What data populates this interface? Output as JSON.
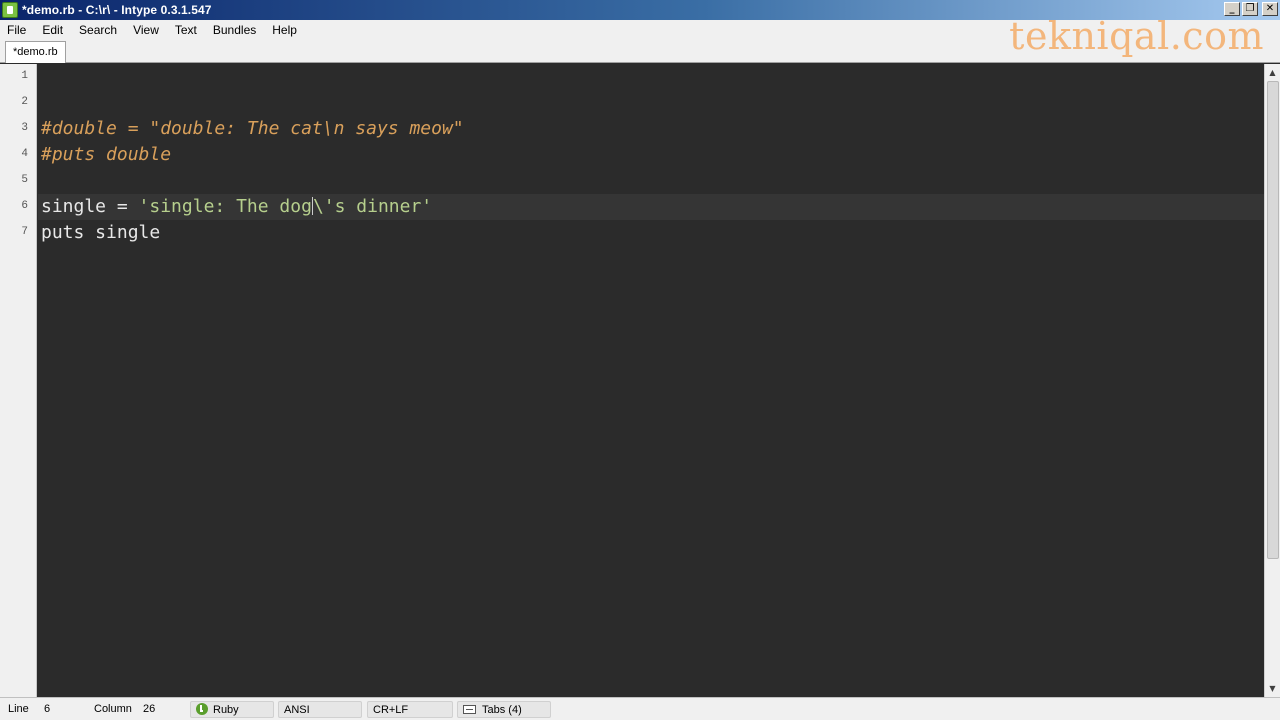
{
  "window": {
    "title": "*demo.rb - C:\\r\\ - Intype 0.3.1.547",
    "controls": {
      "minimize": "_",
      "maximize": "❐",
      "close": "✕"
    }
  },
  "menu": [
    "File",
    "Edit",
    "Search",
    "View",
    "Text",
    "Bundles",
    "Help"
  ],
  "tab": {
    "label": "*demo.rb"
  },
  "watermark": "tekniqal.com",
  "editor": {
    "line_numbers": [
      "1",
      "2",
      "3",
      "4",
      "5",
      "6",
      "7"
    ],
    "current_line": 6,
    "lines": [
      {
        "tokens": []
      },
      {
        "tokens": []
      },
      {
        "tokens": [
          {
            "type": "comment",
            "text": "#double = \"double: The cat\\n says meow\""
          }
        ]
      },
      {
        "tokens": [
          {
            "type": "comment",
            "text": "#puts double"
          }
        ]
      },
      {
        "tokens": []
      },
      {
        "tokens": [
          {
            "type": "ident",
            "text": "single = "
          },
          {
            "type": "string",
            "text": "'single: The dog"
          },
          {
            "type": "caret",
            "text": ""
          },
          {
            "type": "string",
            "text": "\\'s dinner'"
          }
        ]
      },
      {
        "tokens": [
          {
            "type": "ident",
            "text": "puts single"
          }
        ]
      }
    ],
    "colors": {
      "background": "#2b2b2b",
      "comment": "#d9a05b",
      "string": "#b6cf8d",
      "identifier": "#e8e8e8",
      "current_line": "#353535"
    }
  },
  "scrollbar": {
    "up_icon": "▲",
    "down_icon": "▼"
  },
  "status": {
    "line_label": "Line",
    "line_value": "6",
    "column_label": "Column",
    "column_value": "26",
    "language": "Ruby",
    "encoding": "ANSI",
    "line_endings": "CR+LF",
    "indentation": "Tabs (4)"
  }
}
